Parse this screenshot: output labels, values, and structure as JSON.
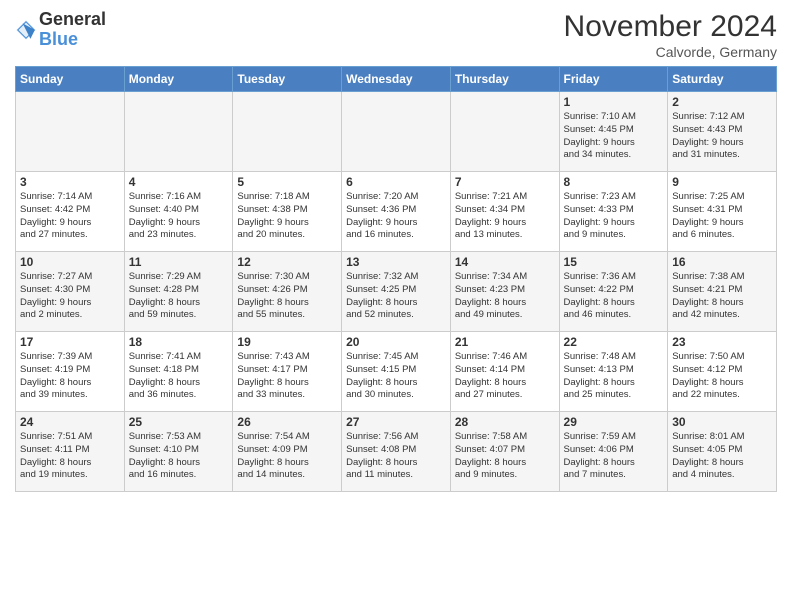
{
  "header": {
    "logo_text_general": "General",
    "logo_text_blue": "Blue",
    "month_title": "November 2024",
    "subtitle": "Calvorde, Germany"
  },
  "weekdays": [
    "Sunday",
    "Monday",
    "Tuesday",
    "Wednesday",
    "Thursday",
    "Friday",
    "Saturday"
  ],
  "weeks": [
    [
      {
        "day": "",
        "info": ""
      },
      {
        "day": "",
        "info": ""
      },
      {
        "day": "",
        "info": ""
      },
      {
        "day": "",
        "info": ""
      },
      {
        "day": "",
        "info": ""
      },
      {
        "day": "1",
        "info": "Sunrise: 7:10 AM\nSunset: 4:45 PM\nDaylight: 9 hours\nand 34 minutes."
      },
      {
        "day": "2",
        "info": "Sunrise: 7:12 AM\nSunset: 4:43 PM\nDaylight: 9 hours\nand 31 minutes."
      }
    ],
    [
      {
        "day": "3",
        "info": "Sunrise: 7:14 AM\nSunset: 4:42 PM\nDaylight: 9 hours\nand 27 minutes."
      },
      {
        "day": "4",
        "info": "Sunrise: 7:16 AM\nSunset: 4:40 PM\nDaylight: 9 hours\nand 23 minutes."
      },
      {
        "day": "5",
        "info": "Sunrise: 7:18 AM\nSunset: 4:38 PM\nDaylight: 9 hours\nand 20 minutes."
      },
      {
        "day": "6",
        "info": "Sunrise: 7:20 AM\nSunset: 4:36 PM\nDaylight: 9 hours\nand 16 minutes."
      },
      {
        "day": "7",
        "info": "Sunrise: 7:21 AM\nSunset: 4:34 PM\nDaylight: 9 hours\nand 13 minutes."
      },
      {
        "day": "8",
        "info": "Sunrise: 7:23 AM\nSunset: 4:33 PM\nDaylight: 9 hours\nand 9 minutes."
      },
      {
        "day": "9",
        "info": "Sunrise: 7:25 AM\nSunset: 4:31 PM\nDaylight: 9 hours\nand 6 minutes."
      }
    ],
    [
      {
        "day": "10",
        "info": "Sunrise: 7:27 AM\nSunset: 4:30 PM\nDaylight: 9 hours\nand 2 minutes."
      },
      {
        "day": "11",
        "info": "Sunrise: 7:29 AM\nSunset: 4:28 PM\nDaylight: 8 hours\nand 59 minutes."
      },
      {
        "day": "12",
        "info": "Sunrise: 7:30 AM\nSunset: 4:26 PM\nDaylight: 8 hours\nand 55 minutes."
      },
      {
        "day": "13",
        "info": "Sunrise: 7:32 AM\nSunset: 4:25 PM\nDaylight: 8 hours\nand 52 minutes."
      },
      {
        "day": "14",
        "info": "Sunrise: 7:34 AM\nSunset: 4:23 PM\nDaylight: 8 hours\nand 49 minutes."
      },
      {
        "day": "15",
        "info": "Sunrise: 7:36 AM\nSunset: 4:22 PM\nDaylight: 8 hours\nand 46 minutes."
      },
      {
        "day": "16",
        "info": "Sunrise: 7:38 AM\nSunset: 4:21 PM\nDaylight: 8 hours\nand 42 minutes."
      }
    ],
    [
      {
        "day": "17",
        "info": "Sunrise: 7:39 AM\nSunset: 4:19 PM\nDaylight: 8 hours\nand 39 minutes."
      },
      {
        "day": "18",
        "info": "Sunrise: 7:41 AM\nSunset: 4:18 PM\nDaylight: 8 hours\nand 36 minutes."
      },
      {
        "day": "19",
        "info": "Sunrise: 7:43 AM\nSunset: 4:17 PM\nDaylight: 8 hours\nand 33 minutes."
      },
      {
        "day": "20",
        "info": "Sunrise: 7:45 AM\nSunset: 4:15 PM\nDaylight: 8 hours\nand 30 minutes."
      },
      {
        "day": "21",
        "info": "Sunrise: 7:46 AM\nSunset: 4:14 PM\nDaylight: 8 hours\nand 27 minutes."
      },
      {
        "day": "22",
        "info": "Sunrise: 7:48 AM\nSunset: 4:13 PM\nDaylight: 8 hours\nand 25 minutes."
      },
      {
        "day": "23",
        "info": "Sunrise: 7:50 AM\nSunset: 4:12 PM\nDaylight: 8 hours\nand 22 minutes."
      }
    ],
    [
      {
        "day": "24",
        "info": "Sunrise: 7:51 AM\nSunset: 4:11 PM\nDaylight: 8 hours\nand 19 minutes."
      },
      {
        "day": "25",
        "info": "Sunrise: 7:53 AM\nSunset: 4:10 PM\nDaylight: 8 hours\nand 16 minutes."
      },
      {
        "day": "26",
        "info": "Sunrise: 7:54 AM\nSunset: 4:09 PM\nDaylight: 8 hours\nand 14 minutes."
      },
      {
        "day": "27",
        "info": "Sunrise: 7:56 AM\nSunset: 4:08 PM\nDaylight: 8 hours\nand 11 minutes."
      },
      {
        "day": "28",
        "info": "Sunrise: 7:58 AM\nSunset: 4:07 PM\nDaylight: 8 hours\nand 9 minutes."
      },
      {
        "day": "29",
        "info": "Sunrise: 7:59 AM\nSunset: 4:06 PM\nDaylight: 8 hours\nand 7 minutes."
      },
      {
        "day": "30",
        "info": "Sunrise: 8:01 AM\nSunset: 4:05 PM\nDaylight: 8 hours\nand 4 minutes."
      }
    ]
  ]
}
